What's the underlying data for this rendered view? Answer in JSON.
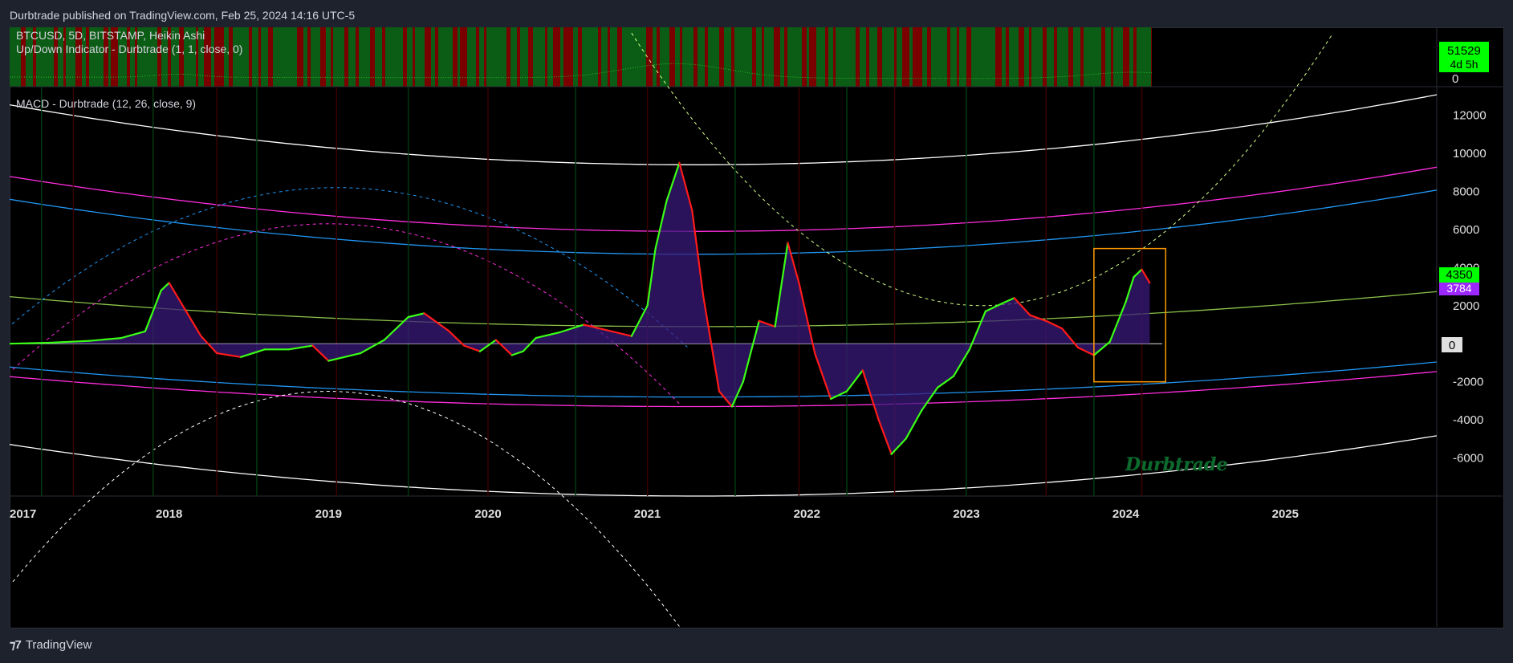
{
  "header": {
    "published": "Durbtrade published on TradingView.com, Feb 25, 2024 14:16 UTC-5"
  },
  "top_pane": {
    "symbol_line": "BTCUSD, 5D, BITSTAMP, Heikin Ashi",
    "indicator_line": "Up/Down Indicator - Durbtrade (1, 1, close, 0)",
    "price_label": "51529",
    "countdown_label": "4d 5h",
    "zero_label": "0",
    "colors": {
      "up": "#0b5c14",
      "down": "#7a0000",
      "price_badge": "#00ff00"
    }
  },
  "bottom_pane": {
    "indicator_line": "MACD - Durbtrade (12, 26, close, 9)",
    "macd_badge": "4350",
    "signal_badge": "3784",
    "zero_badge": "0",
    "watermark": "Durbtrade",
    "colors": {
      "macd_up": "#39ff14",
      "macd_down": "#ff1a1a",
      "fill": "#3a1a7a",
      "fill_neg": "#12127a",
      "signal_badge": "#9c27ff",
      "highlight_box": "#ff9800"
    }
  },
  "footer": {
    "brand": "TradingView",
    "logo": "tv-logo-icon"
  },
  "chart_data": {
    "type": "line",
    "title": "MACD - Durbtrade (12, 26, close, 9)",
    "xlabel": "",
    "ylabel": "",
    "x_ticks": [
      "2017",
      "2018",
      "2019",
      "2020",
      "2021",
      "2022",
      "2023",
      "2024",
      "2025"
    ],
    "y_ticks": [
      "12000",
      "10000",
      "8000",
      "6000",
      "4000",
      "2000",
      "0",
      "-2000",
      "-4000",
      "-6000"
    ],
    "ylim": [
      -8000,
      13500
    ],
    "xlim": [
      2017.0,
      2025.95
    ],
    "grid": false,
    "series": [
      {
        "name": "",
        "x": [
          2017.0,
          2017.25,
          2017.5,
          2017.7,
          2017.85,
          2017.95,
          2018.0,
          2018.1,
          2018.2,
          2018.3,
          2018.45,
          2018.6,
          2018.75,
          2018.9,
          2019.0,
          2019.2,
          2019.35,
          2019.5,
          2019.6,
          2019.75,
          2019.85,
          2019.95,
          2020.05,
          2020.15,
          2020.22,
          2020.3,
          2020.45,
          2020.6,
          2020.75,
          2020.9,
          2021.0,
          2021.05,
          2021.12,
          2021.2,
          2021.28,
          2021.35,
          2021.45,
          2021.53,
          2021.6,
          2021.7,
          2021.8,
          2021.88,
          2021.95,
          2022.05,
          2022.15,
          2022.25,
          2022.35,
          2022.45,
          2022.53,
          2022.62,
          2022.72,
          2022.82,
          2022.92,
          2023.02,
          2023.12,
          2023.22,
          2023.3,
          2023.4,
          2023.5,
          2023.6,
          2023.7,
          2023.8,
          2023.9,
          2024.0,
          2024.05,
          2024.1,
          2024.15
        ],
        "values": [
          0,
          50,
          150,
          300,
          650,
          2800,
          3200,
          1800,
          400,
          -500,
          -700,
          -300,
          -300,
          -100,
          -900,
          -500,
          200,
          1400,
          1600,
          700,
          -100,
          -400,
          200,
          -600,
          -400,
          300,
          600,
          1000,
          700,
          400,
          2000,
          5000,
          7500,
          9500,
          7000,
          2500,
          -2500,
          -3300,
          -2000,
          1200,
          900,
          5300,
          3200,
          -500,
          -2900,
          -2500,
          -1400,
          -4000,
          -5800,
          -5000,
          -3500,
          -2300,
          -1700,
          -300,
          1700,
          2100,
          2400,
          1500,
          1200,
          800,
          -200,
          -600,
          100,
          2200,
          3500,
          3900,
          3200
        ]
      }
    ],
    "highlight": {
      "x_range": [
        2023.8,
        2024.25
      ],
      "y_range": [
        -2000,
        5000
      ]
    }
  }
}
